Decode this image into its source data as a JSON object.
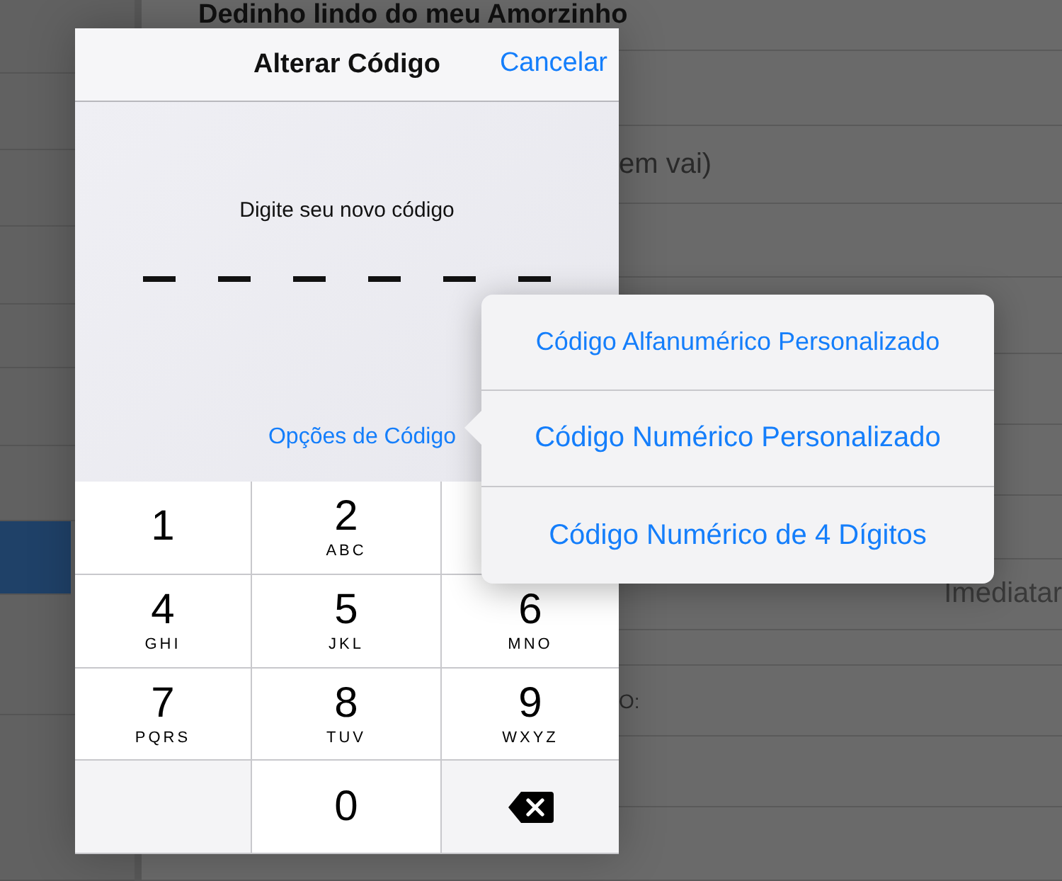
{
  "sidebar": {
    "items": [
      {
        "selected": false
      },
      {
        "selected": false
      },
      {
        "selected": false
      },
      {
        "selected": false
      },
      {
        "selected": false
      },
      {
        "selected": false
      },
      {
        "selected": false
      },
      {
        "selected": true
      },
      {
        "selected": false
      },
      {
        "selected": false
      }
    ]
  },
  "list": {
    "rows": [
      {
        "kind": "title",
        "text": "Dedinho lindo do meu Amorzinho"
      },
      {
        "kind": "empty"
      },
      {
        "kind": "label",
        "text": "em vai)"
      },
      {
        "kind": "empty"
      },
      {
        "kind": "empty"
      },
      {
        "kind": "empty"
      },
      {
        "kind": "empty"
      },
      {
        "kind": "empty"
      },
      {
        "kind": "value",
        "text": "Imediatar"
      },
      {
        "kind": "empty"
      },
      {
        "kind": "label",
        "text": "O:"
      },
      {
        "kind": "empty"
      },
      {
        "kind": "empty"
      }
    ]
  },
  "dialog": {
    "title": "Alterar Código",
    "cancel": "Cancelar",
    "prompt": "Digite seu novo código",
    "slots": [
      {
        "filled": false
      },
      {
        "filled": false
      },
      {
        "filled": false
      },
      {
        "filled": false
      },
      {
        "filled": false
      },
      {
        "filled": false
      }
    ],
    "options_link": "Opções de Código",
    "keys": [
      {
        "kind": "digit",
        "digit": "1"
      },
      {
        "kind": "digit",
        "digit": "2",
        "letters": "ABC"
      },
      {
        "kind": "covered"
      },
      {
        "kind": "digit",
        "digit": "4",
        "letters": "GHI"
      },
      {
        "kind": "digit",
        "digit": "5",
        "letters": "JKL"
      },
      {
        "kind": "digit",
        "digit": "6",
        "letters": "MNO"
      },
      {
        "kind": "digit",
        "digit": "7",
        "letters": "PQRS"
      },
      {
        "kind": "digit",
        "digit": "8",
        "letters": "TUV"
      },
      {
        "kind": "digit",
        "digit": "9",
        "letters": "WXYZ"
      },
      {
        "kind": "blank"
      },
      {
        "kind": "digit",
        "digit": "0"
      },
      {
        "kind": "delete"
      }
    ]
  },
  "popover": {
    "options": [
      "Código Alfanumérico Personalizado",
      "Código Numérico Personalizado",
      "Código Numérico de 4 Dígitos"
    ]
  }
}
